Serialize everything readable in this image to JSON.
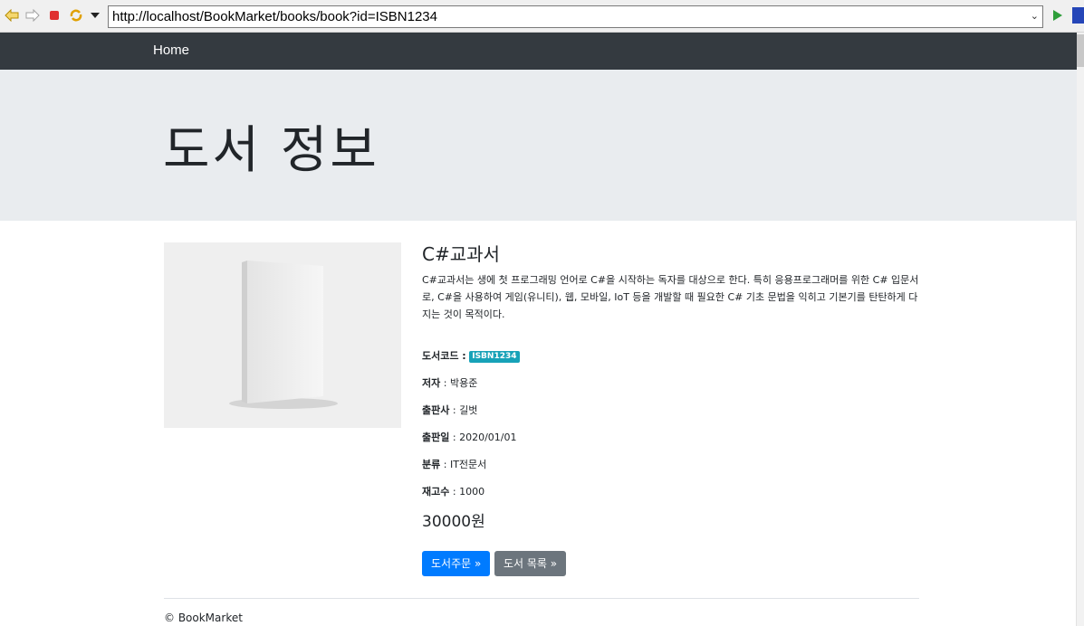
{
  "browser": {
    "url": "http://localhost/BookMarket/books/book?id=ISBN1234"
  },
  "nav": {
    "home": "Home"
  },
  "jumbotron": {
    "title": "도서 정보"
  },
  "book": {
    "title": "C#교과서",
    "description": "C#교과서는 생에 첫 프로그래밍 언어로 C#을 시작하는 독자를 대상으로 한다. 특히 응용프로그래머를 위한 C# 입문서로, C#을 사용하여 게임(유니티), 웹, 모바일, IoT 등을 개발할 때 필요한 C# 기초 문법을 익히고 기본기를 탄탄하게 다지는 것이 목적이다.",
    "code_label": "도서코드 :",
    "code": "ISBN1234",
    "author_label": "저자",
    "author": " : 박용준",
    "publisher_label": "출판사",
    "publisher": " : 길벗",
    "date_label": "출판일",
    "date": " : 2020/01/01",
    "category_label": "분류",
    "category": " : IT전문서",
    "stock_label": "재고수",
    "stock": " : 1000",
    "price": "30000원"
  },
  "buttons": {
    "order": "도서주문 »",
    "list": "도서 목록 »"
  },
  "footer": {
    "text": "© BookMarket"
  },
  "colors": {
    "navbar": "#343a40",
    "jumbotron": "#e9ecef",
    "primary": "#007bff",
    "secondary": "#6c757d",
    "badge": "#17a2b8"
  }
}
